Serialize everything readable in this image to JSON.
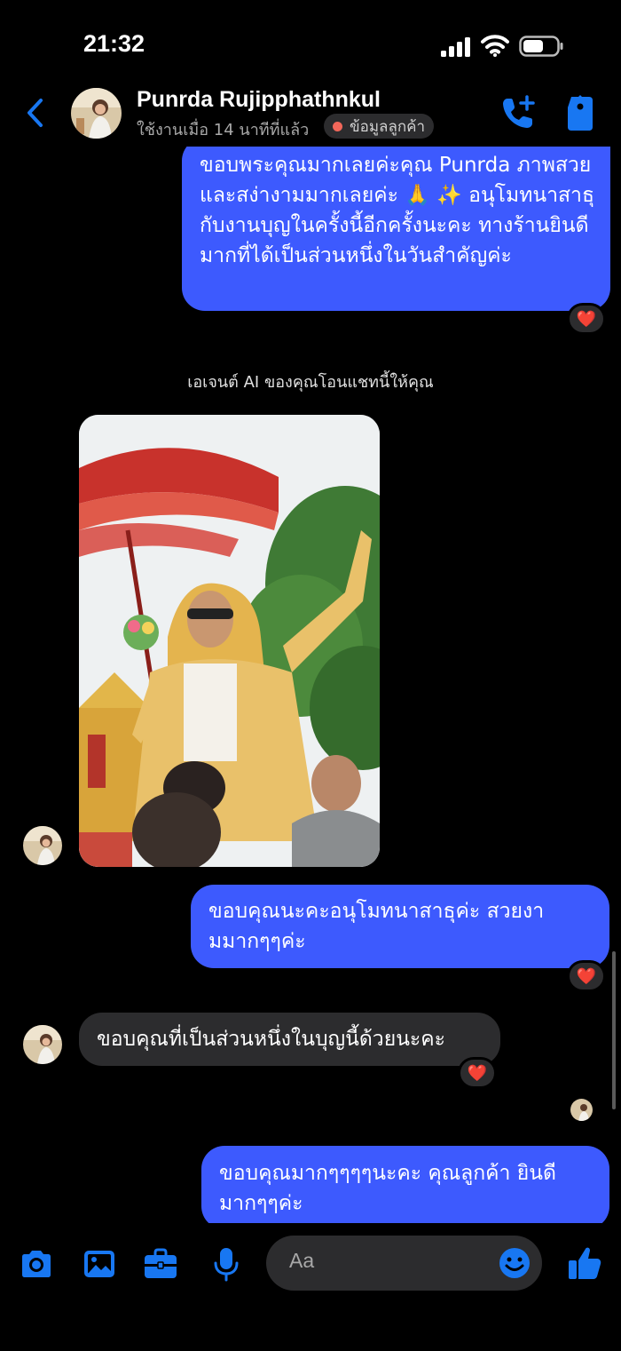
{
  "status_bar": {
    "time": "21:32"
  },
  "header": {
    "contact_name": "Punrda Rujipphathnkul",
    "last_active": "ใช้งานเมื่อ 14 นาทีที่แล้ว",
    "customer_info_label": "ข้อมูลลูกค้า",
    "icons": [
      "back-chevron-icon",
      "phone-add-icon",
      "tag-icon"
    ],
    "accent_color": "#1877f2"
  },
  "messages": [
    {
      "direction": "outgoing",
      "text": "ขอบพระคุณมากเลยค่ะคุณ Punrda ภาพสวยและสง่างามมากเลยค่ะ 🙏 ✨ อนุโมทนาสาธุกับงานบุญในครั้งนี้อีกครั้งนะคะ ทางร้านยินดีมากที่ได้เป็นส่วนหนึ่งในวันสำคัญค่ะ",
      "reaction": "❤️"
    },
    {
      "direction": "system",
      "text": "เอเจนต์ AI ของคุณโอนแชทนี้ให้คุณ"
    },
    {
      "direction": "incoming",
      "type": "photo",
      "photo_subject": "ordination-ceremony-photo"
    },
    {
      "direction": "outgoing",
      "text": "ขอบคุณนะคะอนุโมทนาสาธุค่ะ สวยงามมากๆๆค่ะ",
      "reaction": "❤️"
    },
    {
      "direction": "incoming",
      "text": "ขอบคุณที่เป็นส่วนหนึ่งในบุญนี้ด้วยนะคะ",
      "reaction": "❤️"
    },
    {
      "direction": "outgoing",
      "text": "ขอบคุณมากๆๆๆๆนะคะ คุณลูกค้า ยินดีมากๆๆค่ะ"
    }
  ],
  "composer": {
    "placeholder": "Aa",
    "icons": [
      "camera-icon",
      "gallery-icon",
      "briefcase-icon",
      "microphone-icon",
      "emoji-icon",
      "thumbs-up-icon"
    ]
  },
  "colors": {
    "outgoing_bubble": "#3d5afe",
    "incoming_bubble": "#2c2c2e",
    "background": "#000000",
    "reaction_heart": "#ff3b30"
  }
}
